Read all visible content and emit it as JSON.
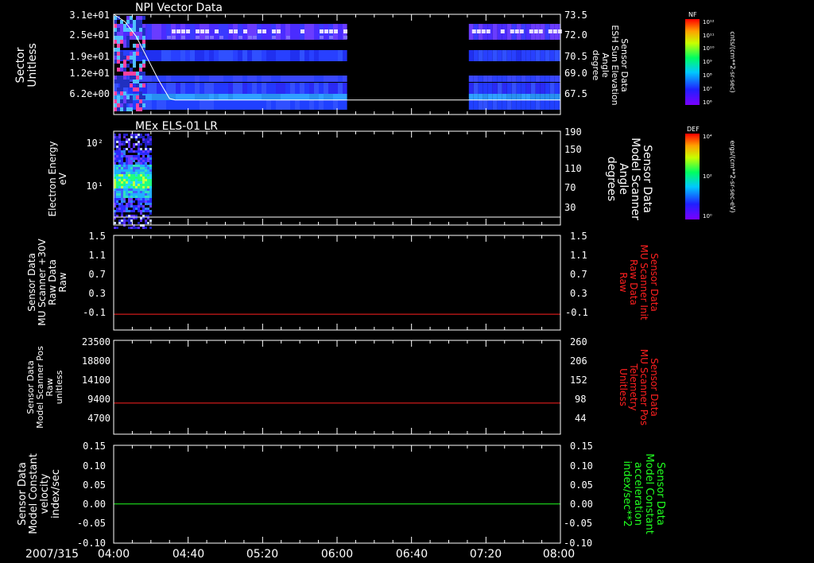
{
  "date_label": "2007/315",
  "colors": {
    "axis": "#ffffff",
    "red_trace": "#ff2020",
    "green_trace": "#20ff20",
    "white_trace": "#ffffff"
  },
  "colorbars": [
    {
      "tag": "NF",
      "unit": "cnts/(cm**2-sr-sec)",
      "ticks": [
        "10¹²",
        "10¹¹",
        "10¹⁰",
        "10⁹",
        "10⁸",
        "10⁷",
        "10⁶"
      ]
    },
    {
      "tag": "DEF",
      "unit": "ergs/(cm**2-sr-sec-eV)",
      "ticks": [
        "10⁴",
        "10²",
        "10⁰"
      ]
    }
  ],
  "chart_data": [
    {
      "type": "heatmap",
      "title": "NPI Vector Data",
      "ylabel": [
        "Sector",
        "Unitless"
      ],
      "yticks": [
        "3.1e+01",
        "2.5e+01",
        "1.9e+01",
        "1.2e+01",
        "6.2e+00"
      ],
      "y2label": [
        "Sensor Data",
        "ESH Sun Elevation",
        "Angle",
        "degree"
      ],
      "y2ticks": [
        "73.5",
        "72.0",
        "70.5",
        "69.0",
        "67.5"
      ],
      "y2lim": [
        66.6,
        73.5
      ],
      "data_gaps_hours": [
        [
          6.09,
          7.18
        ]
      ],
      "overlay_line": {
        "x_hours": [
          4.0,
          4.1,
          4.2,
          4.3,
          4.4,
          4.5,
          4.55,
          8.0
        ],
        "y": [
          73.5,
          73.0,
          72.0,
          70.5,
          69.0,
          67.7,
          67.6,
          67.6
        ]
      }
    },
    {
      "type": "heatmap",
      "title": "MEx ELS-01 LR",
      "ylabel": [
        "Electron Energy",
        "eV"
      ],
      "yticks": [
        "10²",
        "10¹"
      ],
      "ylim": [
        1,
        180
      ],
      "y2label": [
        "Sensor Data",
        "Model Scanner",
        "Angle",
        "degrees"
      ],
      "y2ticks": [
        "190",
        "150",
        "110",
        "70",
        "30"
      ],
      "y2lim": [
        0,
        190
      ],
      "data_range_hours": [
        4.0,
        4.33
      ],
      "overlay_line": {
        "x_hours": [
          4.0,
          8.0
        ],
        "y": [
          10,
          10
        ]
      }
    },
    {
      "type": "line",
      "ylabel": [
        "Sensor Data",
        "MU Scanner +30V",
        "Raw Data",
        "Raw"
      ],
      "yticks": [
        "1.5",
        "1.1",
        "0.7",
        "0.3",
        "-0.1"
      ],
      "ylim": [
        -0.3,
        1.5
      ],
      "y2label": [
        "Sensor Data",
        "MU Scanner Init",
        "Raw Data",
        "Raw"
      ],
      "y2ticks": [
        "1.5",
        "1.1",
        "0.7",
        "0.3",
        "-0.1"
      ],
      "y2lim": [
        -0.3,
        1.5
      ],
      "series": [
        {
          "x_hours": [
            4.0,
            8.0
          ],
          "y": [
            0.0,
            0.0
          ]
        }
      ]
    },
    {
      "type": "line",
      "ylabel": [
        "Sensor Data",
        "Model Scanner Pos",
        "Raw",
        "unitless"
      ],
      "yticks": [
        "23500",
        "18800",
        "14100",
        "9400",
        "4700"
      ],
      "ylim": [
        0,
        23500
      ],
      "y2label": [
        "Sensor Data",
        "MU Scanner Pos",
        "Telemetry",
        "Unitless"
      ],
      "y2ticks": [
        "260",
        "206",
        "152",
        "98",
        "44"
      ],
      "y2lim": [
        0,
        260
      ],
      "series": [
        {
          "x_hours": [
            4.0,
            8.0
          ],
          "y": [
            7800,
            7800
          ]
        }
      ]
    },
    {
      "type": "line",
      "ylabel": [
        "Sensor Data",
        "Model Constant",
        "velocity",
        "index/sec"
      ],
      "yticks": [
        "0.15",
        "0.10",
        "0.05",
        "0.00",
        "-0.05",
        "-0.10"
      ],
      "ylim": [
        -0.1,
        0.15
      ],
      "y2label": [
        "Sensor Data",
        "Model Constant",
        "acceleration",
        "index/sec**2"
      ],
      "y2ticks": [
        "0.15",
        "0.10",
        "0.05",
        "0.00",
        "-0.05",
        "-0.10"
      ],
      "y2lim": [
        -0.1,
        0.15
      ],
      "series": [
        {
          "x_hours": [
            4.0,
            8.0
          ],
          "y": [
            0.0,
            0.0
          ]
        }
      ]
    }
  ],
  "x_axis": {
    "ticks": [
      "04:00",
      "04:40",
      "05:20",
      "06:00",
      "06:40",
      "07:20",
      "08:00"
    ],
    "xlim_hours": [
      4.0,
      8.0
    ]
  }
}
